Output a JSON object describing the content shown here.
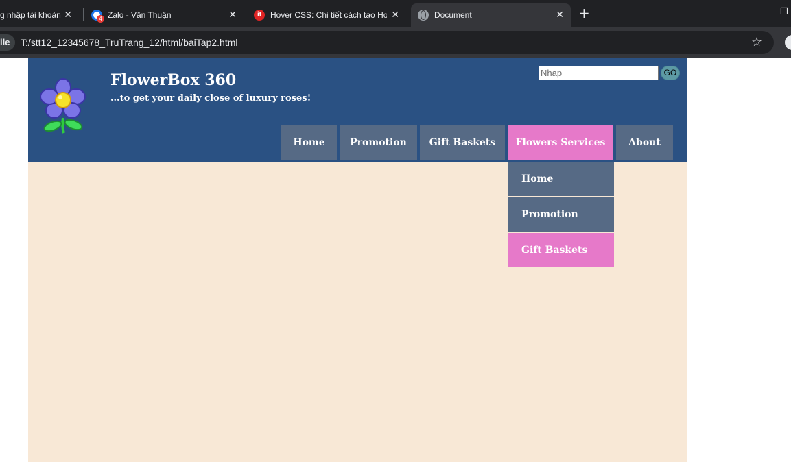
{
  "browser": {
    "tabs": [
      {
        "title": "g nhập tài khoản",
        "icon": "globe-icon"
      },
      {
        "title": "Zalo - Văn Thuận",
        "icon": "zalo-icon",
        "badge": "4"
      },
      {
        "title": "Hover CSS: Chi tiết cách tạo Ho",
        "icon": "it-icon",
        "icon_text": "it"
      },
      {
        "title": "Document",
        "icon": "globe-icon",
        "active": true
      }
    ],
    "close_glyph": "✕",
    "new_tab_glyph": "+",
    "site_chip": "ile",
    "url": "T:/stt12_12345678_TruTrang_12/html/baiTap2.html",
    "star_glyph": "☆",
    "minimize_glyph": "—",
    "restore_glyph": "❐"
  },
  "site": {
    "title": "FlowerBox 360",
    "tagline": "...to get your daily close of luxury roses!",
    "colors": {
      "header": "#2a5183",
      "content": "#f8e8d6",
      "nav": "#566a85",
      "nav_active": "#e679c9"
    }
  },
  "search": {
    "placeholder": "Nhap",
    "value": "",
    "button": "GO"
  },
  "nav": {
    "items": [
      {
        "label": "Home"
      },
      {
        "label": "Promotion"
      },
      {
        "label": "Gift Baskets"
      },
      {
        "label": "Flowers Services",
        "active": true
      },
      {
        "label": "About"
      }
    ]
  },
  "dropdown": {
    "items": [
      {
        "label": "Home"
      },
      {
        "label": "Promotion"
      },
      {
        "label": "Gift Baskets",
        "active": true
      }
    ]
  }
}
